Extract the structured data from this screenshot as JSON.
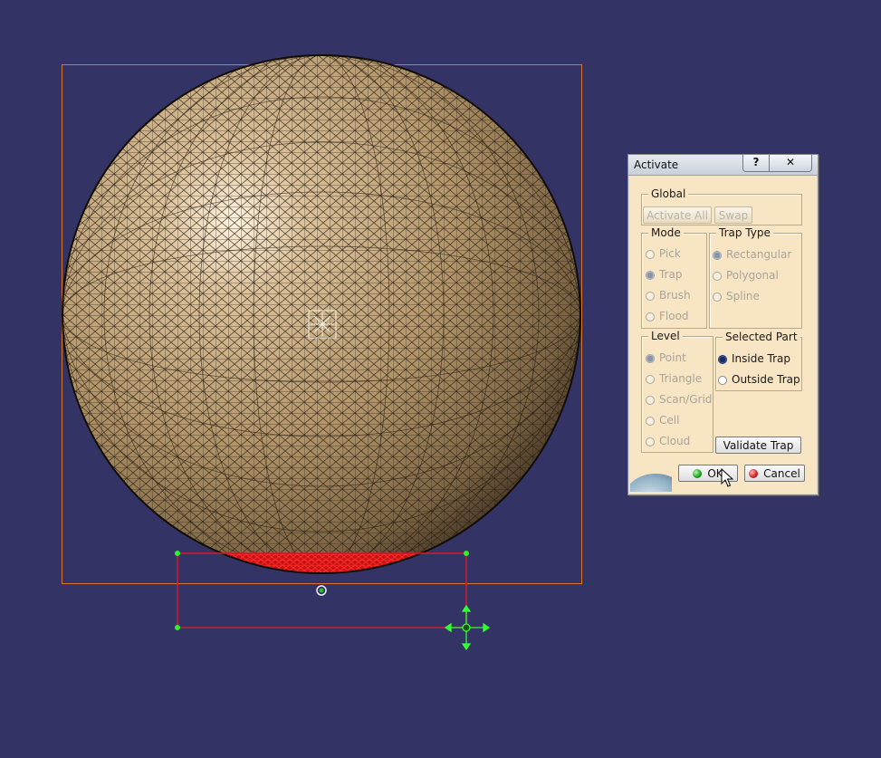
{
  "viewport": {
    "background_color": "#333366",
    "sphere_color": "#c9ab7e",
    "trap_color": "#d41a2a",
    "bbox_color": "#d9762e",
    "handle_color": "#33ff33"
  },
  "dialog": {
    "title": "Activate",
    "help_label": "?",
    "close_label": "✕",
    "global": {
      "label": "Global",
      "activate_all_label": "Activate All",
      "swap_label": "Swap"
    },
    "mode": {
      "label": "Mode",
      "options": [
        "Pick",
        "Trap",
        "Brush",
        "Flood"
      ],
      "selected": "Trap"
    },
    "trap_type": {
      "label": "Trap Type",
      "options": [
        "Rectangular",
        "Polygonal",
        "Spline"
      ],
      "selected": "Rectangular"
    },
    "level": {
      "label": "Level",
      "options": [
        "Point",
        "Triangle",
        "Scan/Grid",
        "Cell",
        "Cloud"
      ],
      "selected": "Point"
    },
    "selected_part": {
      "label": "Selected Part",
      "options": [
        "Inside Trap",
        "Outside Trap"
      ],
      "selected": "Inside Trap"
    },
    "validate_trap_label": "Validate Trap",
    "ok_label": "OK",
    "cancel_label": "Cancel"
  }
}
